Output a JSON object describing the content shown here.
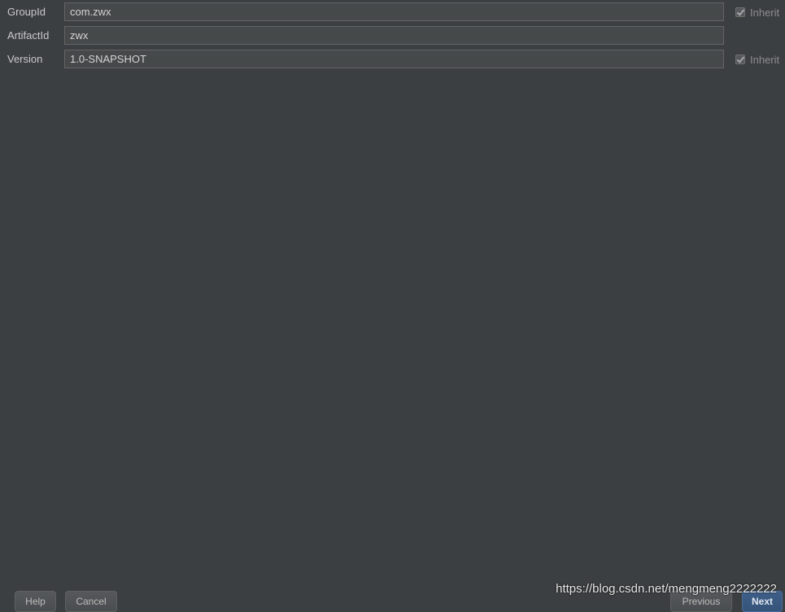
{
  "form": {
    "group_id": {
      "label": "GroupId",
      "value": "com.zwx",
      "inherit_label": "Inherit",
      "inherit_checked": true
    },
    "artifact_id": {
      "label": "ArtifactId",
      "value": "zwx"
    },
    "version": {
      "label": "Version",
      "value": "1.0-SNAPSHOT",
      "inherit_label": "Inherit",
      "inherit_checked": true
    }
  },
  "footer": {
    "help_label": "Help",
    "cancel_label": "Cancel",
    "previous_label": "Previous",
    "next_label": "Next"
  },
  "watermark": "https://blog.csdn.net/mengmeng2222222",
  "colors": {
    "background": "#3c3f41",
    "input_background": "#45494a",
    "primary_button": "#365479"
  }
}
